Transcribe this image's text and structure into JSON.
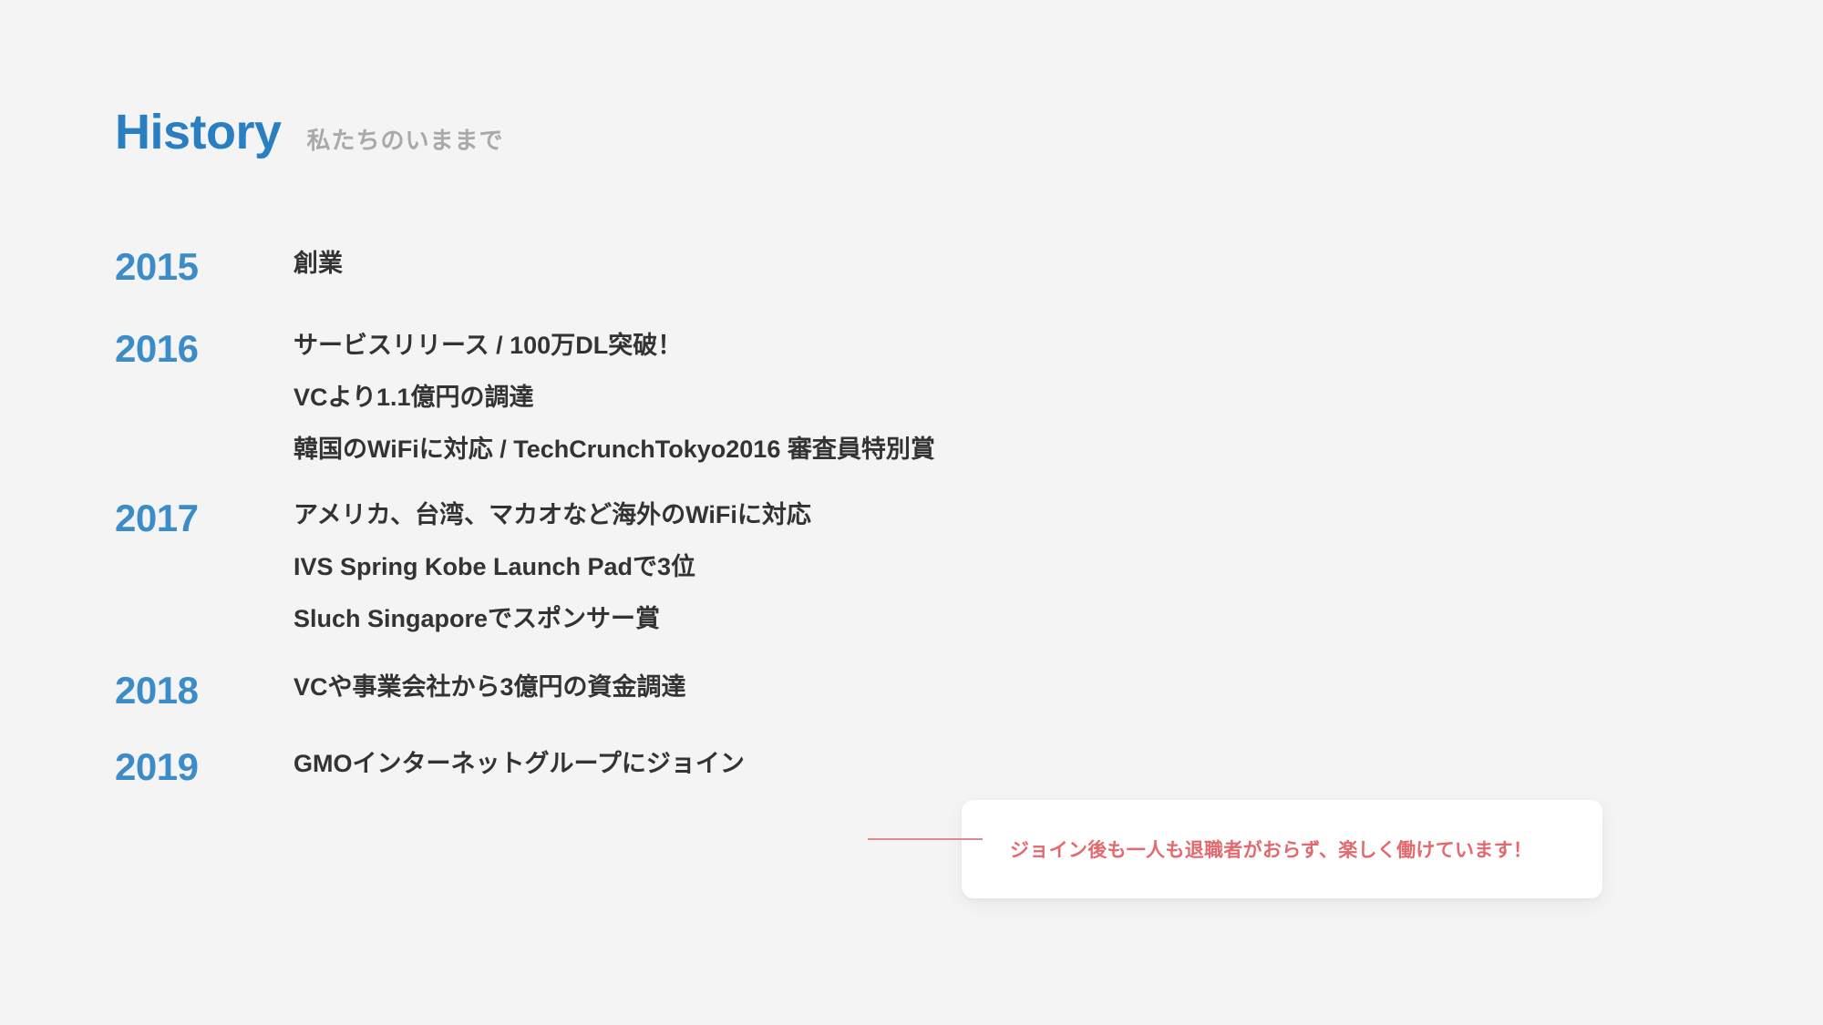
{
  "header": {
    "title": "History",
    "subtitle": "私たちのいままで"
  },
  "colors": {
    "background": "#f4f4f4",
    "title_blue": "#2a7fc1",
    "year_blue": "#3c8cc8",
    "subtitle_gray": "#a9a9a9",
    "body_text": "#333333",
    "callout_pink": "#e3696e",
    "connector_line": "#dd8b8b",
    "card_white": "#ffffff"
  },
  "timeline": {
    "rows": [
      {
        "year": "2015",
        "events": [
          "創業"
        ]
      },
      {
        "year": "2016",
        "events": [
          "サービスリリース / 100万DL突破！",
          "VCより1.1億円の調達",
          "韓国のWiFiに対応 / TechCrunchTokyo2016 審査員特別賞"
        ]
      },
      {
        "year": "2017",
        "events": [
          "アメリカ、台湾、マカオなど海外のWiFiに対応",
          "IVS Spring Kobe Launch Padで3位",
          "Sluch Singaporeでスポンサー賞"
        ]
      },
      {
        "year": "2018",
        "events": [
          "VCや事業会社から3億円の資金調達"
        ]
      },
      {
        "year": "2019",
        "events": [
          "GMOインターネットグループにジョイン"
        ]
      }
    ]
  },
  "callout": {
    "text": "ジョイン後も一人も退職者がおらず、楽しく働けています！"
  }
}
